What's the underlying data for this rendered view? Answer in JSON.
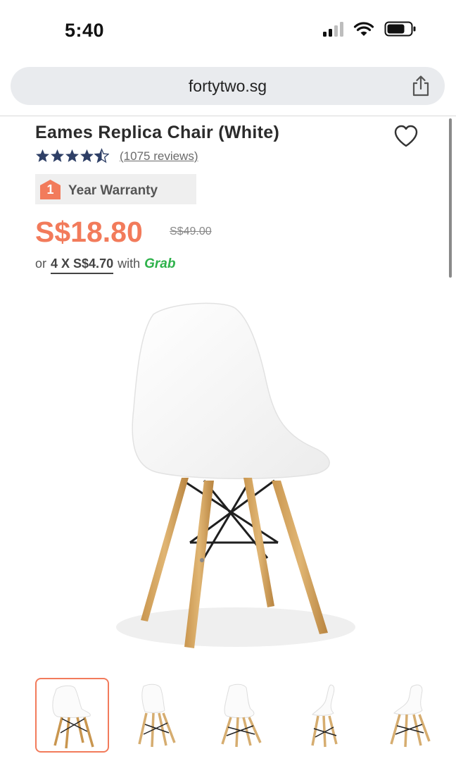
{
  "status_bar": {
    "time": "5:40"
  },
  "browser": {
    "url": "fortytwo.sg"
  },
  "product": {
    "title": "Eames Replica Chair (White)",
    "rating": 4.5,
    "reviews": "(1075 reviews)",
    "warranty_years": "1",
    "warranty_label": "Year Warranty",
    "price": "S$18.80",
    "original_price": "S$49.00",
    "installment_prefix": "or",
    "installment_amount": "4 X S$4.70",
    "installment_with": "with",
    "installment_provider": "Grab"
  },
  "thumbnails": [
    {
      "label": "chair-front-view",
      "selected": true
    },
    {
      "label": "chair-front-angle",
      "selected": false
    },
    {
      "label": "chair-back-angle",
      "selected": false
    },
    {
      "label": "chair-side-view",
      "selected": false
    },
    {
      "label": "chair-side-angle",
      "selected": false
    }
  ],
  "colors": {
    "accent": "#f27b5b",
    "stars": "#2e3f66",
    "grab": "#2eb24b"
  }
}
